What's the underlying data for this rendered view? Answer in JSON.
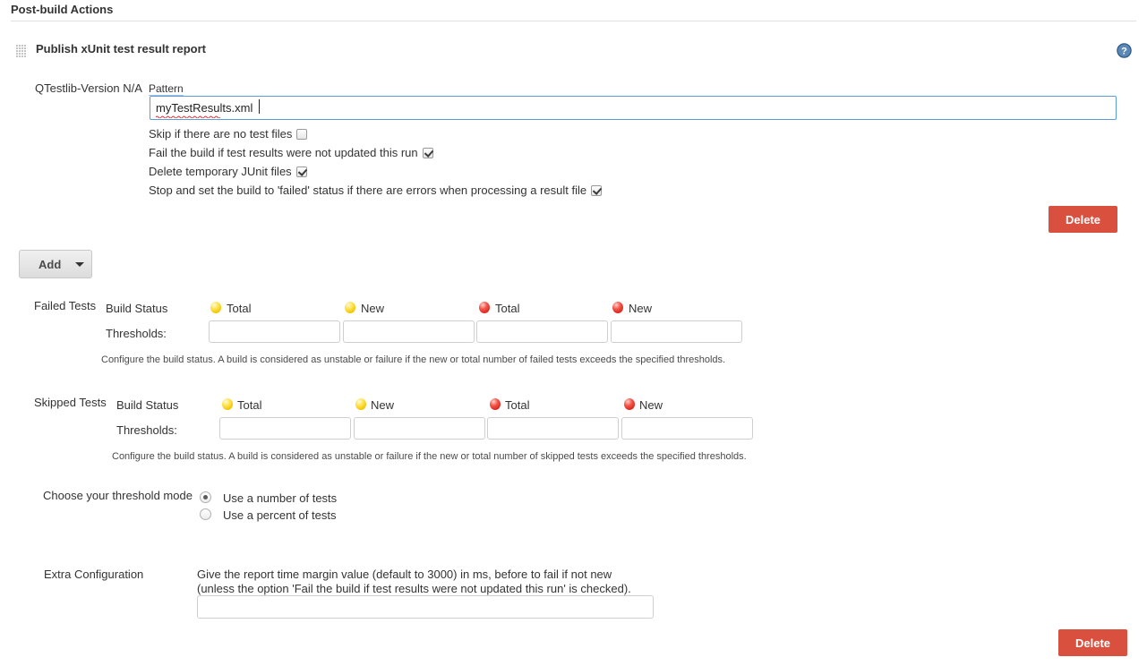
{
  "header": {
    "title": "Post-build Actions"
  },
  "section": {
    "title": "Publish xUnit test result report",
    "grip_icon": "drag-handle-icon",
    "help_icon": "help-question-icon"
  },
  "pattern": {
    "type_label": "QTestlib-Version N/A",
    "field_label": "Pattern",
    "value": "myTestResults.xml",
    "placeholder": ""
  },
  "options": [
    {
      "label": "Skip if there are no test files",
      "checked": false
    },
    {
      "label": "Fail the build if test results were not updated this run",
      "checked": true
    },
    {
      "label": "Delete temporary JUnit files",
      "checked": true
    },
    {
      "label": "Stop and set the build to 'failed' status if there are errors when processing a result file",
      "checked": true
    }
  ],
  "buttons": {
    "delete_top": "Delete",
    "delete_bottom": "Delete",
    "add": "Add",
    "add_caret_icon": "chevron-down-icon"
  },
  "failed_tests": {
    "section_label": "Failed Tests",
    "build_status_label": "Build Status",
    "thresholds_label": "Thresholds:",
    "columns": [
      {
        "icon": "yellow-ball-icon",
        "color": "#f2c500",
        "label": "Total",
        "value": ""
      },
      {
        "icon": "yellow-ball-icon",
        "color": "#f2c500",
        "label": "New",
        "value": ""
      },
      {
        "icon": "red-ball-icon",
        "color": "#d8251a",
        "label": "Total",
        "value": ""
      },
      {
        "icon": "red-ball-icon",
        "color": "#d8251a",
        "label": "New",
        "value": ""
      }
    ],
    "note": "Configure the build status. A build is considered as unstable or failure if the new or total number of failed tests exceeds the specified thresholds."
  },
  "skipped_tests": {
    "section_label": "Skipped Tests",
    "build_status_label": "Build Status",
    "thresholds_label": "Thresholds:",
    "columns": [
      {
        "icon": "yellow-ball-icon",
        "color": "#f2c500",
        "label": "Total",
        "value": ""
      },
      {
        "icon": "yellow-ball-icon",
        "color": "#f2c500",
        "label": "New",
        "value": ""
      },
      {
        "icon": "red-ball-icon",
        "color": "#d8251a",
        "label": "Total",
        "value": ""
      },
      {
        "icon": "red-ball-icon",
        "color": "#d8251a",
        "label": "New",
        "value": ""
      }
    ],
    "note": "Configure the build status. A build is considered as unstable or failure if the new or total number of skipped tests exceeds the specified thresholds."
  },
  "threshold_mode": {
    "label": "Choose your threshold mode",
    "options": [
      {
        "label": "Use a number of tests",
        "selected": true
      },
      {
        "label": "Use a percent of tests",
        "selected": false
      }
    ]
  },
  "extra_configuration": {
    "label": "Extra Configuration",
    "description_line1": "Give the report time margin value (default to 3000) in ms, before to fail if not new",
    "description_line2": "(unless the option 'Fail the build if test results were not updated this run' is checked).",
    "value": "",
    "placeholder": ""
  },
  "colors": {
    "delete_button": "#d9503f",
    "focus_border": "#5b9dd9",
    "help_icon": "#3c6ea5"
  }
}
